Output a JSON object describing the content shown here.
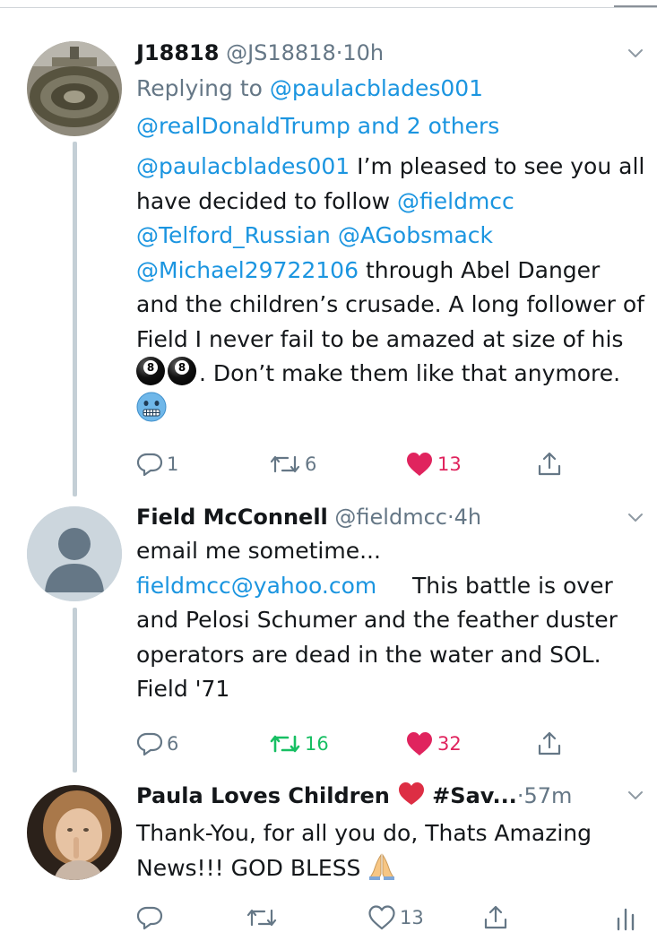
{
  "tweets": [
    {
      "name": "J18818",
      "handle": "@JS18818",
      "separator": "·",
      "time": "10h",
      "replying_prefix": "Replying to",
      "replying_to_1": "@paulacblades001",
      "replying_to_2": "@realDonaldTrump and 2 others",
      "body": {
        "mention_1": "@paulacblades001",
        "text_1": " I’m pleased to see you all have decided to follow ",
        "mention_2": "@fieldmcc",
        "mention_3": "@Telford_Russian",
        "mention_4": "@AGobsmack",
        "mention_5": "@Michael29722106",
        "text_2": " through Abel Danger and the children’s crusade. A long follower of Field I never fail to be amazed at size of his ",
        "text_3": ". Don’t make them like that anymore. ",
        "emojis": [
          "8-ball-icon",
          "8-ball-icon",
          "cold-face-icon"
        ]
      },
      "replies": "1",
      "retweets": "6",
      "likes": "13",
      "liked": true,
      "retweeted": false
    },
    {
      "name": "Field McConnell",
      "handle": "@fieldmcc",
      "separator": "·",
      "time": "4h",
      "body": {
        "line_1": "email me sometime...",
        "email": "fieldmcc@yahoo.com",
        "text_1": "     This battle is over and Pelosi Schumer and the feather duster operators are dead in the water and SOL.  Field '71"
      },
      "replies": "6",
      "retweets": "16",
      "likes": "32",
      "liked": true,
      "retweeted": true
    },
    {
      "name": "Paula Loves Children",
      "name_emoji": "red-heart-icon",
      "name_suffix": "#Sav...",
      "separator": "·",
      "time": "57m",
      "body": {
        "text_1": "Thank-You, for all you do, Thats Amazing News!!!  GOD BLESS ",
        "emoji": "folded-hands-icon"
      },
      "replies": "",
      "retweets": "",
      "likes": "13",
      "liked": false,
      "retweeted": false
    }
  ],
  "colors": {
    "link": "#1b95e0",
    "secondary_text": "#657786",
    "like_active": "#e0245e",
    "retweet_active": "#17bf63",
    "thread_line": "#c4cfd6"
  }
}
